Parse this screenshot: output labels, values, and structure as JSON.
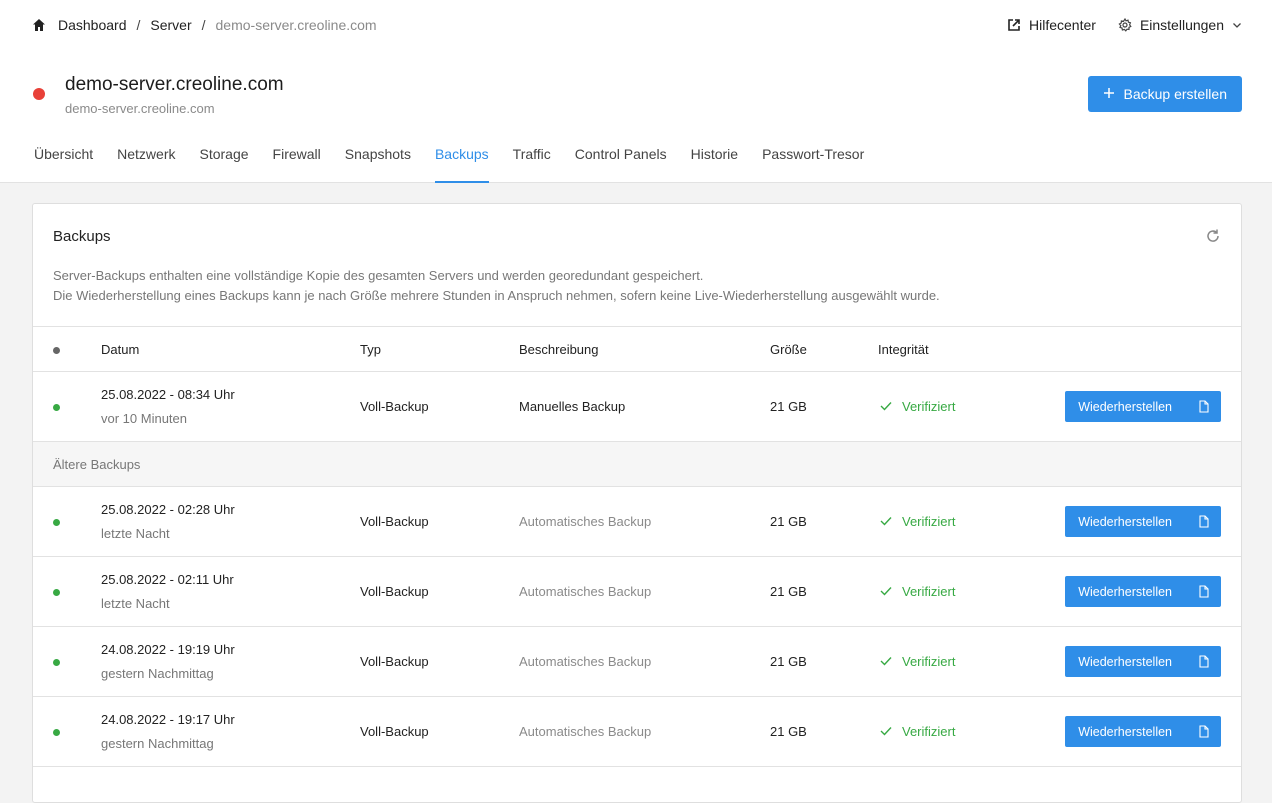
{
  "breadcrumb": {
    "home_icon": "home-icon",
    "items": [
      "Dashboard",
      "Server",
      "demo-server.creoline.com"
    ],
    "separator": "/"
  },
  "topnav": {
    "help": {
      "label": "Hilfecenter",
      "icon": "external-link-icon"
    },
    "settings": {
      "label": "Einstellungen",
      "icon": "gear-icon"
    }
  },
  "server": {
    "name": "demo-server.creoline.com",
    "hostname": "demo-server.creoline.com",
    "status_color": "#e84038"
  },
  "actions": {
    "create_backup": "Backup erstellen"
  },
  "tabs": [
    {
      "label": "Übersicht"
    },
    {
      "label": "Netzwerk"
    },
    {
      "label": "Storage"
    },
    {
      "label": "Firewall"
    },
    {
      "label": "Snapshots"
    },
    {
      "label": "Backups",
      "active": true
    },
    {
      "label": "Traffic"
    },
    {
      "label": "Control Panels"
    },
    {
      "label": "Historie"
    },
    {
      "label": "Passwort-Tresor"
    }
  ],
  "backups": {
    "title": "Backups",
    "description_line1": "Server-Backups enthalten eine vollständige Kopie des gesamten Servers und werden georedundant gespeichert.",
    "description_line2": "Die Wiederherstellung eines Backups kann je nach Größe mehrere Stunden in Anspruch nehmen, sofern keine Live-Wiederherstellung ausgewählt wurde.",
    "columns": {
      "date": "Datum",
      "type": "Typ",
      "description": "Beschreibung",
      "size": "Größe",
      "integrity": "Integrität"
    },
    "restore_label": "Wiederherstellen",
    "older_label": "Ältere Backups",
    "latest": [
      {
        "date": "25.08.2022 - 08:34 Uhr",
        "relative": "vor 10 Minuten",
        "type": "Voll-Backup",
        "description": "Manuelles Backup",
        "size": "21 GB",
        "integrity": "Verifiziert"
      }
    ],
    "older": [
      {
        "date": "25.08.2022 - 02:28 Uhr",
        "relative": "letzte Nacht",
        "type": "Voll-Backup",
        "description": "Automatisches Backup",
        "size": "21 GB",
        "integrity": "Verifiziert"
      },
      {
        "date": "25.08.2022 - 02:11 Uhr",
        "relative": "letzte Nacht",
        "type": "Voll-Backup",
        "description": "Automatisches Backup",
        "size": "21 GB",
        "integrity": "Verifiziert"
      },
      {
        "date": "24.08.2022 - 19:19 Uhr",
        "relative": "gestern Nachmittag",
        "type": "Voll-Backup",
        "description": "Automatisches Backup",
        "size": "21 GB",
        "integrity": "Verifiziert"
      },
      {
        "date": "24.08.2022 - 19:17 Uhr",
        "relative": "gestern Nachmittag",
        "type": "Voll-Backup",
        "description": "Automatisches Backup",
        "size": "21 GB",
        "integrity": "Verifiziert"
      }
    ]
  },
  "colors": {
    "accent": "#2f8ee8",
    "success": "#37a943",
    "danger": "#e84038"
  }
}
